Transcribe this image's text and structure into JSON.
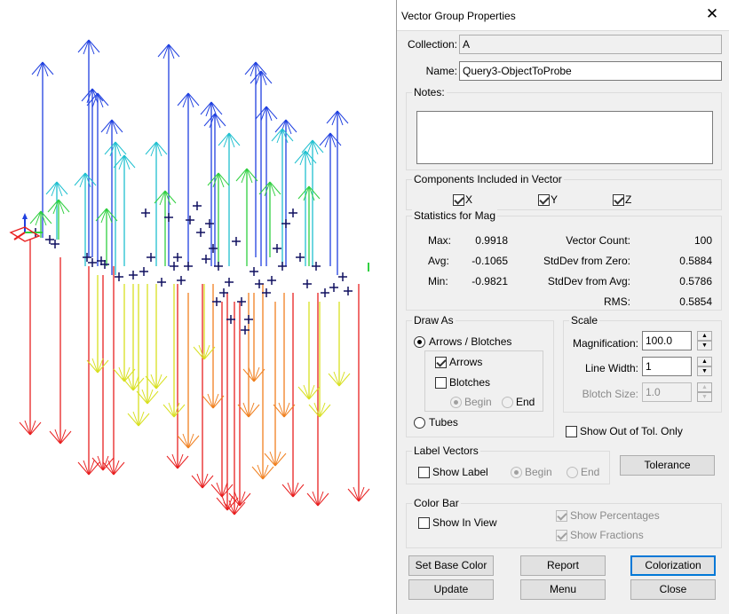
{
  "dialog": {
    "title": "Vector Group Properties",
    "close_glyph": "✕",
    "collection_label": "Collection:",
    "collection_value": "A",
    "name_label": "Name:",
    "name_value": "Query3-ObjectToProbe",
    "notes_label": "Notes:",
    "notes_value": ""
  },
  "components": {
    "title": "Components Included in Vector",
    "x": {
      "label": "X",
      "checked": true
    },
    "y": {
      "label": "Y",
      "checked": true
    },
    "z": {
      "label": "Z",
      "checked": true
    }
  },
  "statistics": {
    "title": "Statistics for Mag",
    "max_label": "Max:",
    "max_value": "0.9918",
    "avg_label": "Avg:",
    "avg_value": "-0.1065",
    "min_label": "Min:",
    "min_value": "-0.9821",
    "count_label": "Vector Count:",
    "count_value": "100",
    "sd_zero_label": "StdDev from Zero:",
    "sd_zero_value": "0.5884",
    "sd_avg_label": "StdDev from  Avg:",
    "sd_avg_value": "0.5786",
    "rms_label": "RMS:",
    "rms_value": "0.5854"
  },
  "draw_as": {
    "title": "Draw As",
    "arrows_blotches": "Arrows / Blotches",
    "arrows": "Arrows",
    "blotches": "Blotches",
    "begin": "Begin",
    "end": "End",
    "tubes": "Tubes"
  },
  "scale": {
    "title": "Scale",
    "magnification_label": "Magnification:",
    "magnification_value": "100.0",
    "line_width_label": "Line Width:",
    "line_width_value": "1",
    "blotch_size_label": "Blotch Size:",
    "blotch_size_value": "1.0"
  },
  "show_out_of_tol": "Show Out of Tol. Only",
  "label_vectors": {
    "title": "Label Vectors",
    "show_label": "Show Label",
    "begin": "Begin",
    "end": "End"
  },
  "tolerance_button": "Tolerance",
  "color_bar": {
    "title": "Color Bar",
    "show_in_view": "Show In View",
    "show_percentages": "Show Percentages",
    "show_fractions": "Show Fractions"
  },
  "buttons": {
    "set_base_color": "Set Base Color",
    "report": "Report",
    "colorization": "Colorization",
    "update": "Update",
    "menu": "Menu",
    "close": "Close"
  },
  "colors": {
    "blue": "#2040e0",
    "cyan": "#20c0d0",
    "green": "#30d040",
    "yellow": "#d8e020",
    "orange": "#f08020",
    "red": "#e82020",
    "marker": "#101060",
    "focus": "#0078d7"
  }
}
